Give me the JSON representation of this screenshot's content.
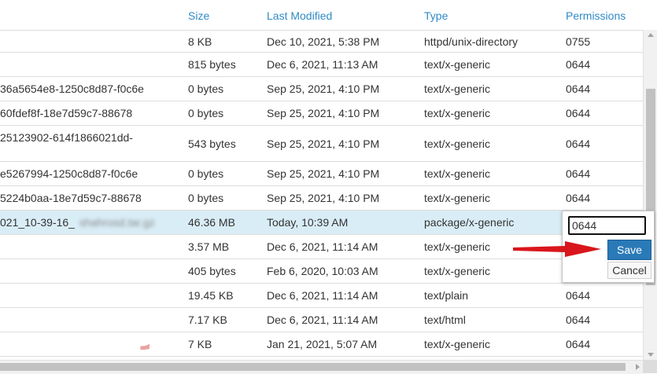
{
  "columns": {
    "size": "Size",
    "last_modified": "Last Modified",
    "type": "Type",
    "permissions": "Permissions"
  },
  "rows": [
    {
      "name": "",
      "size": "8 KB",
      "modified": "Dec 10, 2021, 5:38 PM",
      "type": "httpd/unix-directory",
      "perms": "0755"
    },
    {
      "name": "",
      "size": "815 bytes",
      "modified": "Dec 6, 2021, 11:13 AM",
      "type": "text/x-generic",
      "perms": "0644"
    },
    {
      "name": "36a5654e8-1250c8d87-f0c6e",
      "size": "0 bytes",
      "modified": "Sep 25, 2021, 4:10 PM",
      "type": "text/x-generic",
      "perms": "0644"
    },
    {
      "name": "60fdef8f-18e7d59c7-88678",
      "size": "0 bytes",
      "modified": "Sep 25, 2021, 4:10 PM",
      "type": "text/x-generic",
      "perms": "0644"
    },
    {
      "name": "25123902-614f1866021dd-",
      "size": "543 bytes",
      "modified": "Sep 25, 2021, 4:10 PM",
      "type": "text/x-generic",
      "perms": "0644"
    },
    {
      "name": "e5267994-1250c8d87-f0c6e",
      "size": "0 bytes",
      "modified": "Sep 25, 2021, 4:10 PM",
      "type": "text/x-generic",
      "perms": "0644"
    },
    {
      "name": "5224b0aa-18e7d59c7-88678",
      "size": "0 bytes",
      "modified": "Sep 25, 2021, 4:10 PM",
      "type": "text/x-generic",
      "perms": "0644"
    },
    {
      "name": "021_10-39-16_",
      "name_blurred": "shahrosd.tar.gz",
      "size": "46.36 MB",
      "modified": "Today, 10:39 AM",
      "type": "package/x-generic",
      "perms": ""
    },
    {
      "name": "",
      "size": "3.57 MB",
      "modified": "Dec 6, 2021, 11:14 AM",
      "type": "text/x-generic",
      "perms": ""
    },
    {
      "name": "",
      "size": "405 bytes",
      "modified": "Feb 6, 2020, 10:03 AM",
      "type": "text/x-generic",
      "perms": ""
    },
    {
      "name": "",
      "size": "19.45 KB",
      "modified": "Dec 6, 2021, 11:14 AM",
      "type": "text/plain",
      "perms": "0644"
    },
    {
      "name": "",
      "size": "7.17 KB",
      "modified": "Dec 6, 2021, 11:14 AM",
      "type": "text/html",
      "perms": "0644"
    },
    {
      "name": "",
      "size": "7 KB",
      "modified": "Jan 21, 2021, 5:07 AM",
      "type": "text/x-generic",
      "perms": "0644"
    }
  ],
  "perm_editor": {
    "value": "0644",
    "save_label": "Save",
    "cancel_label": "Cancel"
  },
  "watermark_text": "وب رمز",
  "colors": {
    "header_link": "#2f8ac6",
    "selected_row": "#d9edf7",
    "save_button": "#2a7ab8",
    "annotation_arrow": "#d9161c",
    "watermark": "#e3867f"
  },
  "icons": {
    "annotation": "red-arrow-icon",
    "scroll_up": "chevron-up-icon",
    "scroll_down": "chevron-down-icon",
    "scroll_right": "chevron-right-icon"
  }
}
